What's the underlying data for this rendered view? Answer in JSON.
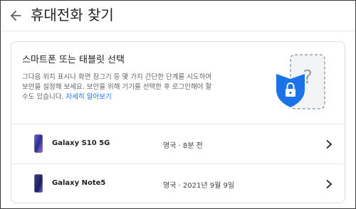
{
  "header": {
    "title": "휴대전화 찾기",
    "back_icon": "arrow-back-icon"
  },
  "card": {
    "title": "스마트폰 또는 태블릿 선택",
    "description_line1": "그다음 위치 표시나 화면 잠그기 등 몇 가지 간단한 단계를 시도하여",
    "description_line2": "보안을 설정해 보세요. 보안을 위해 기기를 선택한 후 로그인해야 할",
    "description_line3_prefix": "수도 있습니다. ",
    "learn_more_link": "자세히 알아보기",
    "illustration_icon": "device-security-illustration",
    "accent_color": "#1a73e8"
  },
  "devices": [
    {
      "name": "Galaxy S10 5G",
      "status": "영국 · 8분 전",
      "icon": "phone-icon",
      "chevron": "chevron-right-icon"
    },
    {
      "name": "Galaxy Note5",
      "status": "영국 · 2021년 9월 9일",
      "icon": "phone-icon",
      "chevron": "chevron-right-icon"
    }
  ]
}
